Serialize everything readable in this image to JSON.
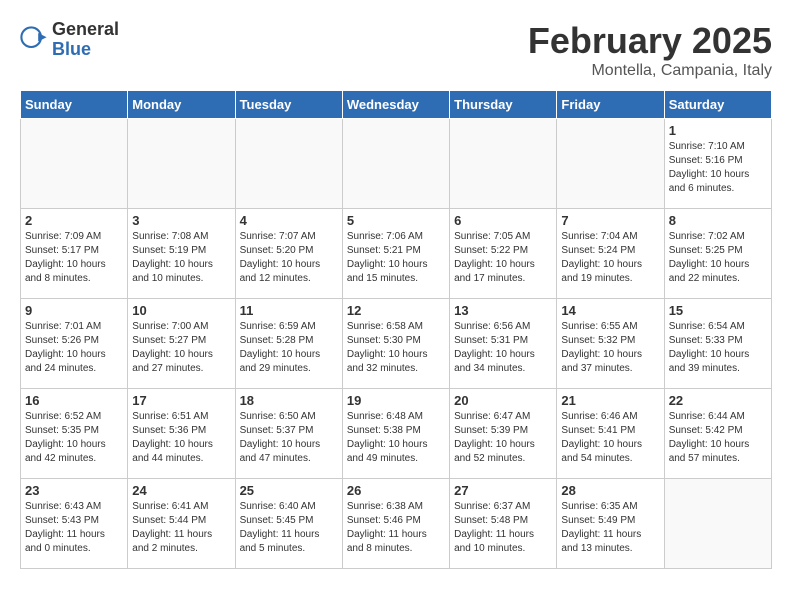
{
  "logo": {
    "general": "General",
    "blue": "Blue"
  },
  "title": "February 2025",
  "subtitle": "Montella, Campania, Italy",
  "weekdays": [
    "Sunday",
    "Monday",
    "Tuesday",
    "Wednesday",
    "Thursday",
    "Friday",
    "Saturday"
  ],
  "weeks": [
    [
      {
        "day": "",
        "info": ""
      },
      {
        "day": "",
        "info": ""
      },
      {
        "day": "",
        "info": ""
      },
      {
        "day": "",
        "info": ""
      },
      {
        "day": "",
        "info": ""
      },
      {
        "day": "",
        "info": ""
      },
      {
        "day": "1",
        "info": "Sunrise: 7:10 AM\nSunset: 5:16 PM\nDaylight: 10 hours\nand 6 minutes."
      }
    ],
    [
      {
        "day": "2",
        "info": "Sunrise: 7:09 AM\nSunset: 5:17 PM\nDaylight: 10 hours\nand 8 minutes."
      },
      {
        "day": "3",
        "info": "Sunrise: 7:08 AM\nSunset: 5:19 PM\nDaylight: 10 hours\nand 10 minutes."
      },
      {
        "day": "4",
        "info": "Sunrise: 7:07 AM\nSunset: 5:20 PM\nDaylight: 10 hours\nand 12 minutes."
      },
      {
        "day": "5",
        "info": "Sunrise: 7:06 AM\nSunset: 5:21 PM\nDaylight: 10 hours\nand 15 minutes."
      },
      {
        "day": "6",
        "info": "Sunrise: 7:05 AM\nSunset: 5:22 PM\nDaylight: 10 hours\nand 17 minutes."
      },
      {
        "day": "7",
        "info": "Sunrise: 7:04 AM\nSunset: 5:24 PM\nDaylight: 10 hours\nand 19 minutes."
      },
      {
        "day": "8",
        "info": "Sunrise: 7:02 AM\nSunset: 5:25 PM\nDaylight: 10 hours\nand 22 minutes."
      }
    ],
    [
      {
        "day": "9",
        "info": "Sunrise: 7:01 AM\nSunset: 5:26 PM\nDaylight: 10 hours\nand 24 minutes."
      },
      {
        "day": "10",
        "info": "Sunrise: 7:00 AM\nSunset: 5:27 PM\nDaylight: 10 hours\nand 27 minutes."
      },
      {
        "day": "11",
        "info": "Sunrise: 6:59 AM\nSunset: 5:28 PM\nDaylight: 10 hours\nand 29 minutes."
      },
      {
        "day": "12",
        "info": "Sunrise: 6:58 AM\nSunset: 5:30 PM\nDaylight: 10 hours\nand 32 minutes."
      },
      {
        "day": "13",
        "info": "Sunrise: 6:56 AM\nSunset: 5:31 PM\nDaylight: 10 hours\nand 34 minutes."
      },
      {
        "day": "14",
        "info": "Sunrise: 6:55 AM\nSunset: 5:32 PM\nDaylight: 10 hours\nand 37 minutes."
      },
      {
        "day": "15",
        "info": "Sunrise: 6:54 AM\nSunset: 5:33 PM\nDaylight: 10 hours\nand 39 minutes."
      }
    ],
    [
      {
        "day": "16",
        "info": "Sunrise: 6:52 AM\nSunset: 5:35 PM\nDaylight: 10 hours\nand 42 minutes."
      },
      {
        "day": "17",
        "info": "Sunrise: 6:51 AM\nSunset: 5:36 PM\nDaylight: 10 hours\nand 44 minutes."
      },
      {
        "day": "18",
        "info": "Sunrise: 6:50 AM\nSunset: 5:37 PM\nDaylight: 10 hours\nand 47 minutes."
      },
      {
        "day": "19",
        "info": "Sunrise: 6:48 AM\nSunset: 5:38 PM\nDaylight: 10 hours\nand 49 minutes."
      },
      {
        "day": "20",
        "info": "Sunrise: 6:47 AM\nSunset: 5:39 PM\nDaylight: 10 hours\nand 52 minutes."
      },
      {
        "day": "21",
        "info": "Sunrise: 6:46 AM\nSunset: 5:41 PM\nDaylight: 10 hours\nand 54 minutes."
      },
      {
        "day": "22",
        "info": "Sunrise: 6:44 AM\nSunset: 5:42 PM\nDaylight: 10 hours\nand 57 minutes."
      }
    ],
    [
      {
        "day": "23",
        "info": "Sunrise: 6:43 AM\nSunset: 5:43 PM\nDaylight: 11 hours\nand 0 minutes."
      },
      {
        "day": "24",
        "info": "Sunrise: 6:41 AM\nSunset: 5:44 PM\nDaylight: 11 hours\nand 2 minutes."
      },
      {
        "day": "25",
        "info": "Sunrise: 6:40 AM\nSunset: 5:45 PM\nDaylight: 11 hours\nand 5 minutes."
      },
      {
        "day": "26",
        "info": "Sunrise: 6:38 AM\nSunset: 5:46 PM\nDaylight: 11 hours\nand 8 minutes."
      },
      {
        "day": "27",
        "info": "Sunrise: 6:37 AM\nSunset: 5:48 PM\nDaylight: 11 hours\nand 10 minutes."
      },
      {
        "day": "28",
        "info": "Sunrise: 6:35 AM\nSunset: 5:49 PM\nDaylight: 11 hours\nand 13 minutes."
      },
      {
        "day": "",
        "info": ""
      }
    ]
  ]
}
